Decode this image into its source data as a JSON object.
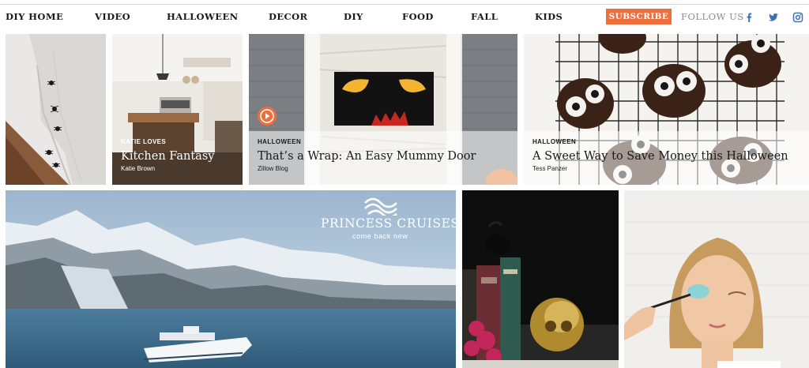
{
  "nav": {
    "items": [
      "DIY HOME",
      "VIDEO",
      "HALLOWEEN",
      "DECOR",
      "DIY",
      "FOOD",
      "FALL",
      "KIDS"
    ],
    "subscribe_label": "SUBSCRIBE",
    "follow_label": "FOLLOW US",
    "social_icons": [
      "facebook-icon",
      "twitter-icon",
      "instagram-icon"
    ]
  },
  "colors": {
    "accent": "#ee6e3c",
    "social_blue": "#3b6fb6",
    "text": "#1a1a1a"
  },
  "tiles": {
    "kitchen": {
      "category": "KATIE LOVES",
      "title": "Kitchen Fantasy",
      "author": "Katie Brown"
    },
    "mummy": {
      "category": "HALLOWEEN",
      "title": "That’s a Wrap: An Easy Mummy Door",
      "author": "Zillow Blog",
      "has_video": true
    },
    "pretzels": {
      "category": "HALLOWEEN",
      "title": "A Sweet Way to Save Money this Halloween",
      "author": "Tess Panzer"
    }
  },
  "ad": {
    "brand": "PRINCESS CRUISES",
    "tagline": "come back new"
  }
}
